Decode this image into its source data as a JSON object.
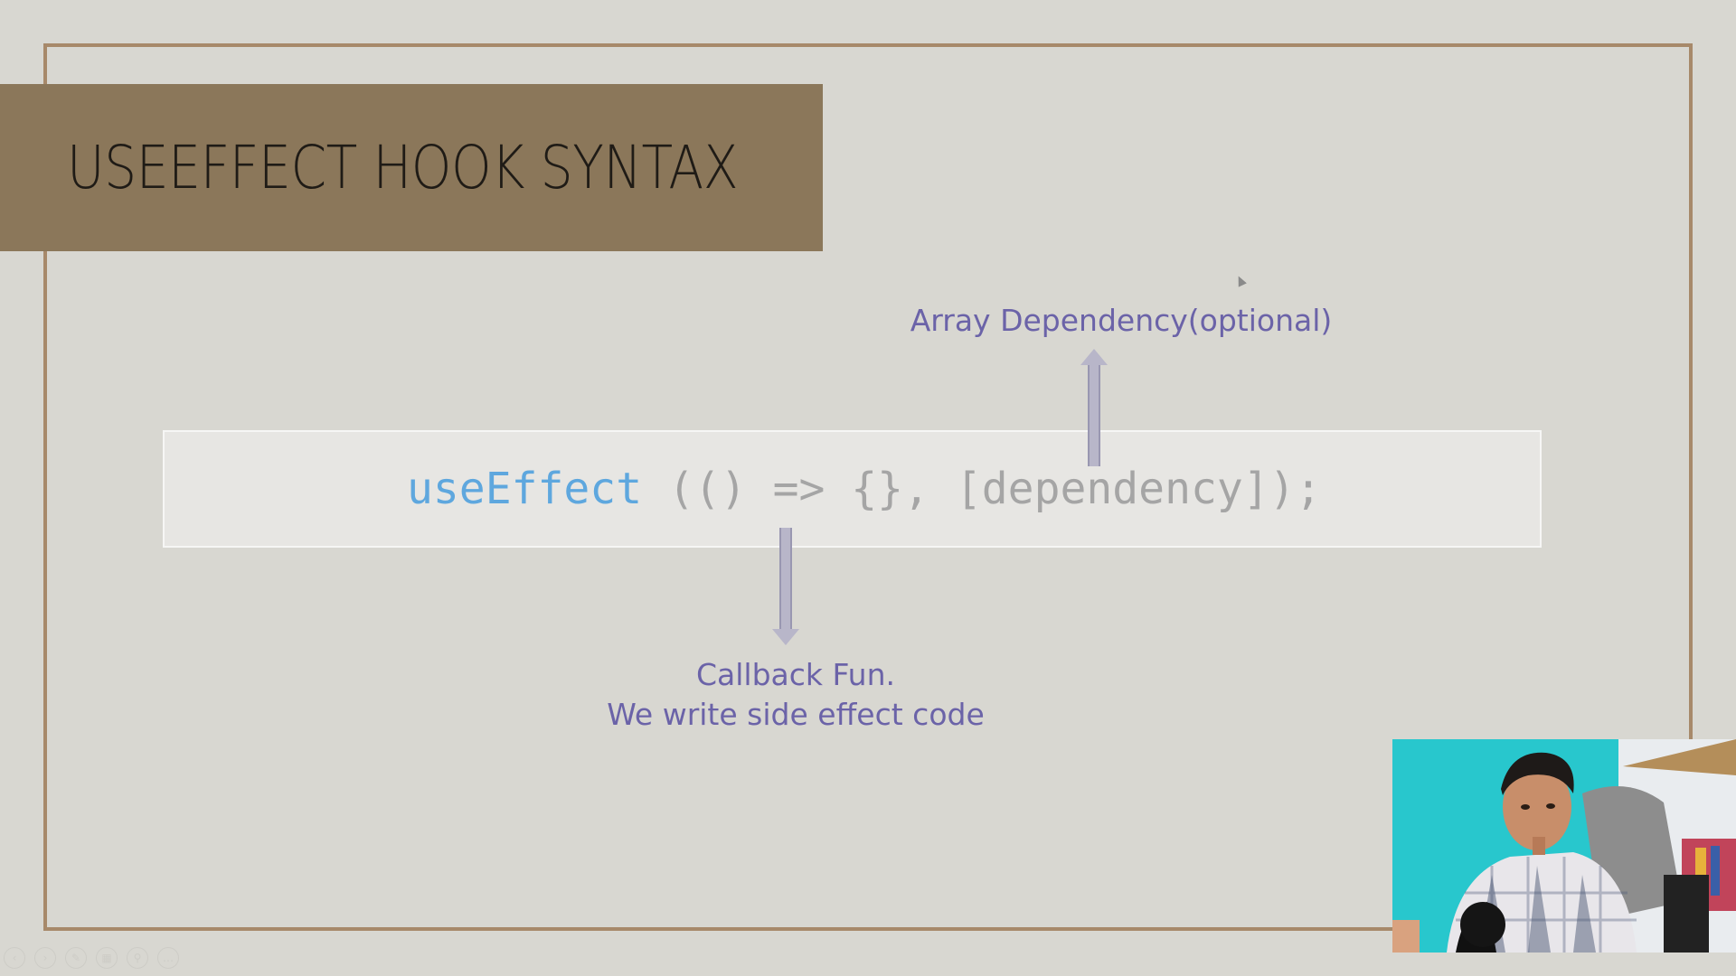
{
  "slide": {
    "title": "USEEFFECT HOOK SYNTAX",
    "code": {
      "function_name": "useEffect",
      "rest": " (() => {}, [dependency]);"
    },
    "annotations": {
      "array_dependency": "Array Dependency(optional)",
      "callback_line1": "Callback Fun.",
      "callback_line2": "We write side effect code"
    }
  },
  "colors": {
    "background": "#d8d7d1",
    "frame_border": "#a7896a",
    "title_band": "#8b775a",
    "code_function": "#5ea7de",
    "code_rest": "#a5a5a5",
    "annotation_text": "#6b63a8",
    "arrow": "#b8b6c9"
  },
  "playback_controls": {
    "icons": [
      "previous-icon",
      "next-icon",
      "pen-icon",
      "slides-grid-icon",
      "zoom-icon",
      "more-icon"
    ],
    "glyphs": [
      "‹",
      "›",
      "✎",
      "▦",
      "⚲",
      "…"
    ]
  },
  "webcam": {
    "description_icon": "presenter-video-icon"
  }
}
